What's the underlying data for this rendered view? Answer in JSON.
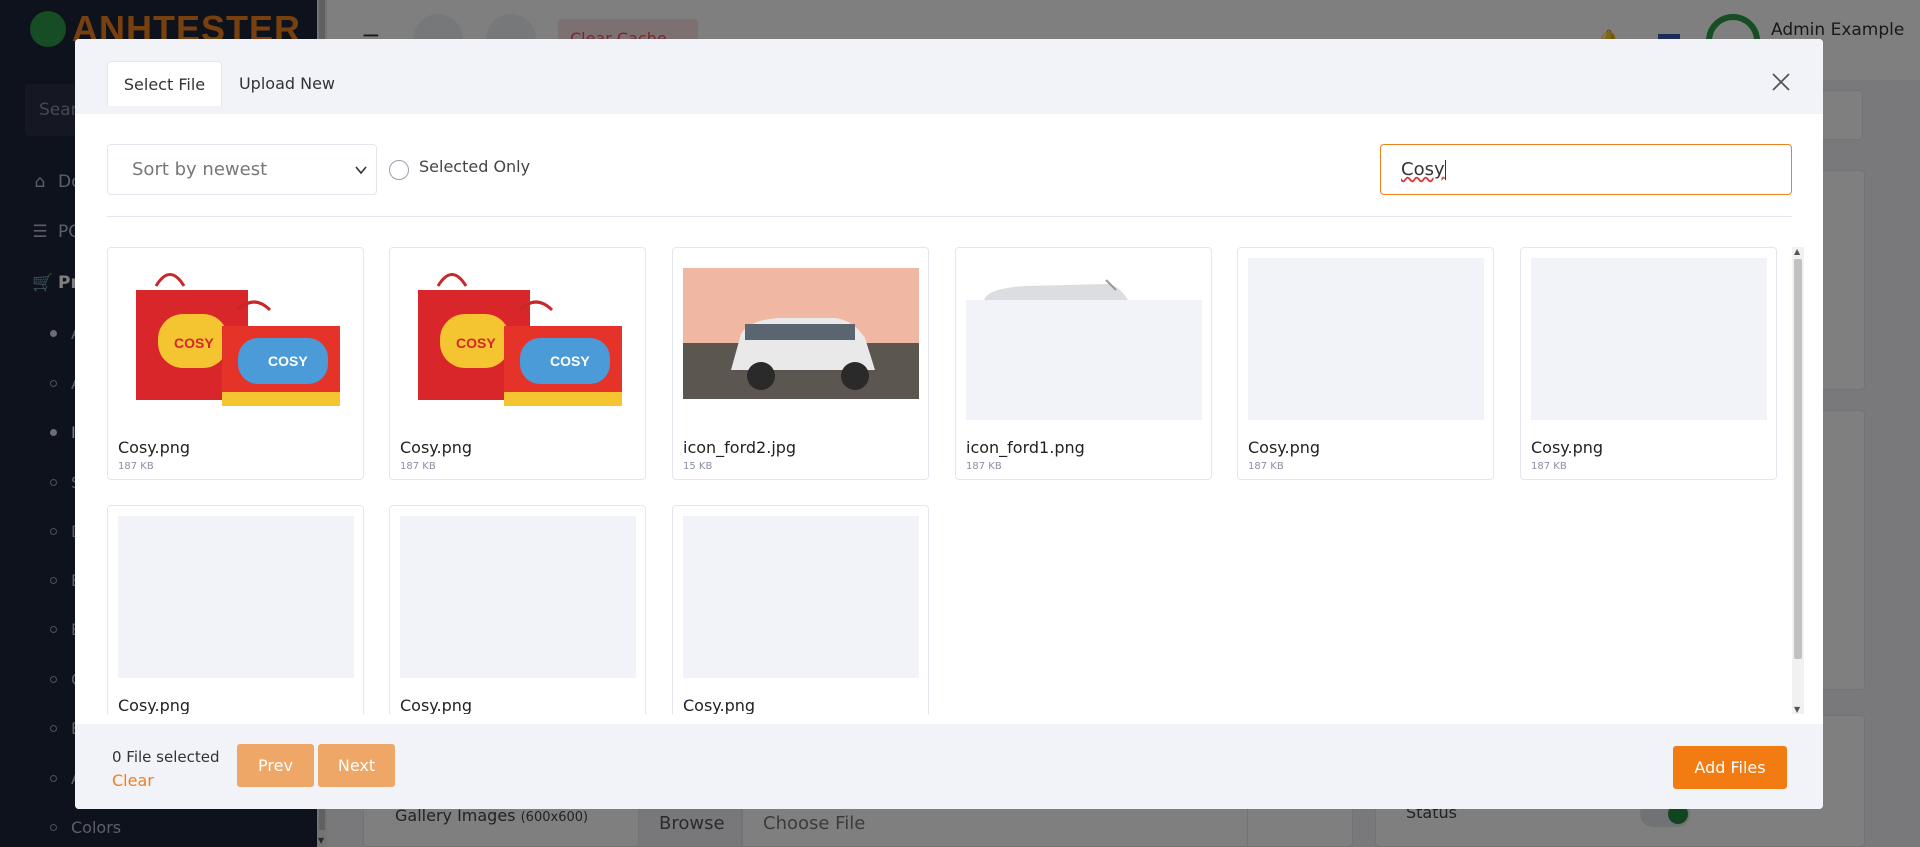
{
  "background": {
    "logo": {
      "text": "ANHTESTER"
    },
    "sidebar": {
      "search_placeholder": "Sear",
      "items": [
        {
          "label": "Do",
          "icon": "home-icon"
        },
        {
          "label": "PO",
          "icon": "list-icon"
        },
        {
          "label": "Pro",
          "icon": "cart-icon"
        }
      ],
      "subitems": [
        "A",
        "A",
        "In",
        "S",
        "D",
        "B",
        "B",
        "C",
        "B",
        "A",
        "Colors"
      ]
    },
    "topbar": {
      "clear_cache": "Clear Cache",
      "user_name": "Admin Example"
    },
    "gallery_label": "Gallery Images",
    "gallery_hint": "(600x600)",
    "browse_label": "Browse",
    "choose_file_label": "Choose File",
    "status_label": "Status"
  },
  "modal": {
    "tabs": [
      {
        "label": "Select File",
        "active": true
      },
      {
        "label": "Upload New",
        "active": false
      }
    ],
    "sort": {
      "selected": "Sort by newest"
    },
    "selected_only_label": "Selected Only",
    "search": {
      "value": "Cosy"
    },
    "files": [
      {
        "name": "Cosy.png",
        "size": "187 KB",
        "thumb": "gift-box"
      },
      {
        "name": "Cosy.png",
        "size": "187 KB",
        "thumb": "gift-box"
      },
      {
        "name": "icon_ford2.jpg",
        "size": "15 KB",
        "thumb": "car-photo"
      },
      {
        "name": "icon_ford1.png",
        "size": "187 KB",
        "thumb": "car-partial"
      },
      {
        "name": "Cosy.png",
        "size": "187 KB",
        "thumb": "blank"
      },
      {
        "name": "Cosy.png",
        "size": "187 KB",
        "thumb": "blank"
      },
      {
        "name": "Cosy.png",
        "size": "",
        "thumb": "blank"
      },
      {
        "name": "Cosy.png",
        "size": "",
        "thumb": "blank"
      },
      {
        "name": "Cosy.png",
        "size": "",
        "thumb": "blank"
      }
    ],
    "footer": {
      "selected_count": "0 File selected",
      "clear": "Clear",
      "prev": "Prev",
      "next": "Next",
      "add_files": "Add Files"
    }
  },
  "colors": {
    "accent": "#f27b12",
    "accent_muted": "#eea766",
    "sidebar_bg": "#1d2438",
    "brand_green": "#2e9a48"
  }
}
